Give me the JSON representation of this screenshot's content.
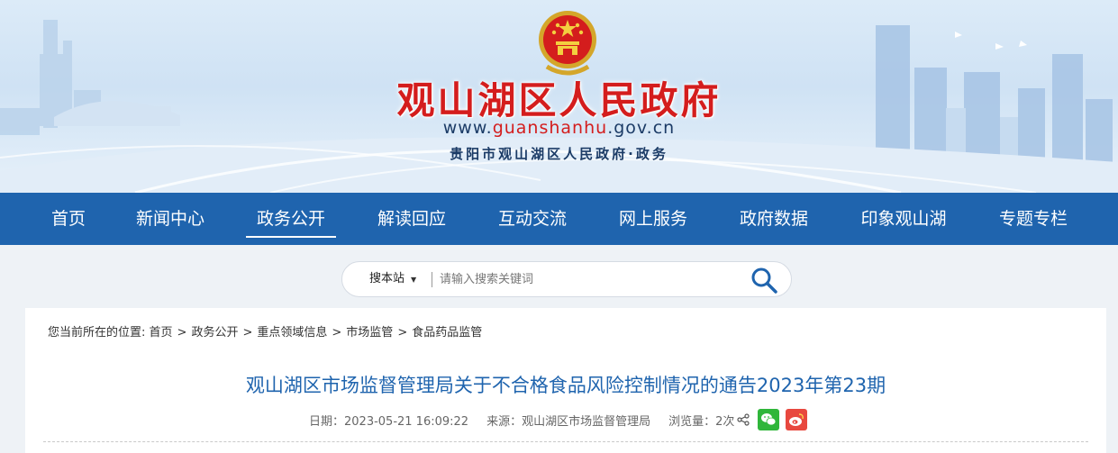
{
  "header": {
    "title": "观山湖区人民政府",
    "url_prefix": "www.",
    "url_highlight": "guanshanhu",
    "url_suffix": ".gov.cn",
    "subtitle": "贵阳市观山湖区人民政府·政务"
  },
  "nav": {
    "items": [
      {
        "label": "首页"
      },
      {
        "label": "新闻中心"
      },
      {
        "label": "政务公开",
        "active": true
      },
      {
        "label": "解读回应"
      },
      {
        "label": "互动交流"
      },
      {
        "label": "网上服务"
      },
      {
        "label": "政府数据"
      },
      {
        "label": "印象观山湖"
      },
      {
        "label": "专题专栏"
      }
    ]
  },
  "search": {
    "scope": "搜本站",
    "placeholder": "请输入搜索关键词",
    "icon": "magnifier-icon"
  },
  "breadcrumb": {
    "prefix": "您当前所在的位置:",
    "items": [
      "首页",
      "政务公开",
      "重点领域信息",
      "市场监管",
      "食品药品监管"
    ]
  },
  "article": {
    "title": "观山湖区市场监督管理局关于不合格食品风险控制情况的通告2023年第23期",
    "date": "日期：2023-05-21 16:09:22",
    "source": "来源：观山湖区市场监督管理局",
    "views": "浏览量：2次"
  },
  "colors": {
    "nav_bg": "#1f64ae",
    "title_red": "#d41d1d",
    "article_title": "#1f64ae",
    "wechat": "#2fb63a",
    "weibo": "#e8483f"
  }
}
